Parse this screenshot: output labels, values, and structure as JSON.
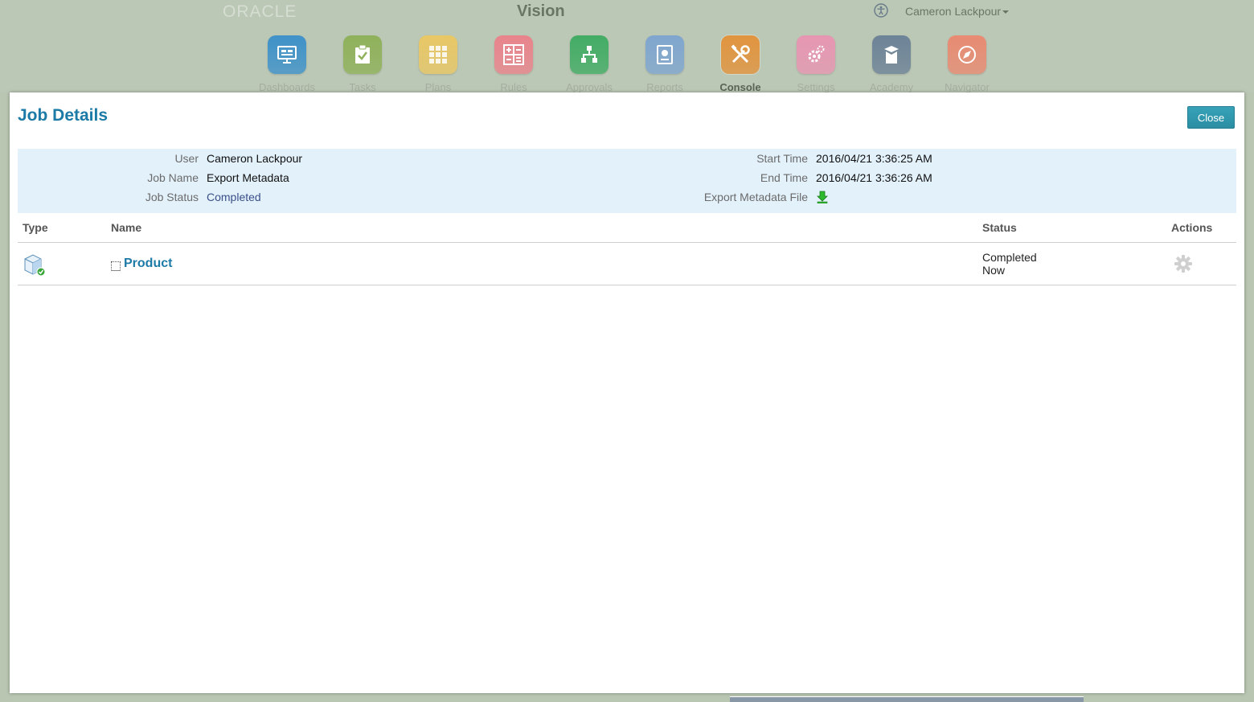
{
  "header": {
    "brand": "ORACLE",
    "app_title": "Vision",
    "user_name": "Cameron Lackpour"
  },
  "nav": [
    {
      "label": "Dashboards",
      "icon": "dashboards-icon",
      "color": "#3f92c9"
    },
    {
      "label": "Tasks",
      "icon": "tasks-icon",
      "color": "#8fb15a"
    },
    {
      "label": "Plans",
      "icon": "plans-icon",
      "color": "#e8c766"
    },
    {
      "label": "Rules",
      "icon": "rules-icon",
      "color": "#e9848c"
    },
    {
      "label": "Approvals",
      "icon": "approvals-icon",
      "color": "#42ac64"
    },
    {
      "label": "Reports",
      "icon": "reports-icon",
      "color": "#7fa6cf"
    },
    {
      "label": "Console",
      "icon": "console-icon",
      "color": "#e1943e",
      "active": true
    },
    {
      "label": "Settings",
      "icon": "settings-icon",
      "color": "#e796b2"
    },
    {
      "label": "Academy",
      "icon": "academy-icon",
      "color": "#6d8397"
    },
    {
      "label": "Navigator",
      "icon": "navigator-icon",
      "color": "#e88b72"
    }
  ],
  "modal": {
    "title": "Job Details",
    "close_label": "Close",
    "info": {
      "user_label": "User",
      "user_value": "Cameron Lackpour",
      "job_name_label": "Job Name",
      "job_name_value": "Export Metadata",
      "job_status_label": "Job Status",
      "job_status_value": "Completed",
      "start_time_label": "Start Time",
      "start_time_value": "2016/04/21 3:36:25 AM",
      "end_time_label": "End Time",
      "end_time_value": "2016/04/21 3:36:26 AM",
      "export_file_label": "Export Metadata File"
    },
    "columns": {
      "type": "Type",
      "name": "Name",
      "status": "Status",
      "actions": "Actions"
    },
    "rows": [
      {
        "name": "Product",
        "status": "Completed",
        "status_time": "Now"
      }
    ]
  },
  "colors": {
    "accent": "#1c7aa6",
    "close_button": "#2f97ad",
    "info_panel": "#e3f1fb",
    "backdrop": "#b9c6b2"
  }
}
